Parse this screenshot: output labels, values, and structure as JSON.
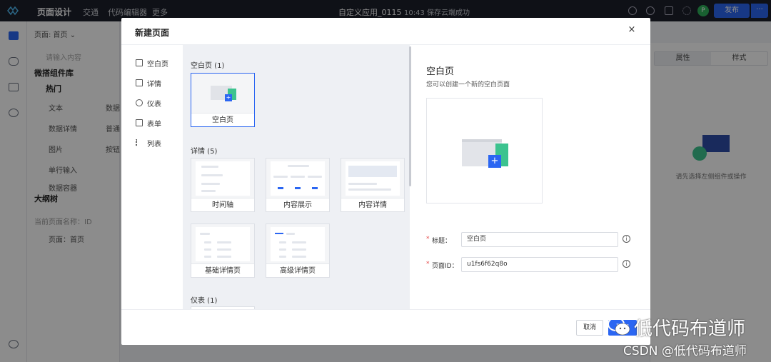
{
  "app": {
    "title": "页面设计",
    "nav": [
      "交通",
      "代码编辑器",
      "更多"
    ],
    "center_title": "自定义应用_0115",
    "save_status": "10:43 保存云端成功",
    "user_initial": "P",
    "publish_label": "发布",
    "more_label": "···"
  },
  "sidepanel": {
    "page_label": "页面: 首页 ⌄",
    "search_placeholder": "请输入内容",
    "library_title": "微搭组件库",
    "hot_title": "热门",
    "components": [
      "文本",
      "数据",
      "数据详情",
      "普通",
      "图片",
      "按钮",
      "单行输入",
      "数据容器"
    ],
    "outline_title": "大纲树",
    "outline_hint": "当前页面名称：ID",
    "outline_item": "页面：首页"
  },
  "rightpanel": {
    "tabs": [
      "属性",
      "样式"
    ],
    "hint": "请先选择左侧组件或操作"
  },
  "modal": {
    "title": "新建页面",
    "close": "×",
    "categories": [
      {
        "label": "空白页",
        "icon": "page-icon"
      },
      {
        "label": "详情",
        "icon": "detail-icon"
      },
      {
        "label": "仪表",
        "icon": "gauge-icon"
      },
      {
        "label": "表单",
        "icon": "checkbox-icon"
      },
      {
        "label": "列表",
        "icon": "list-icon"
      }
    ],
    "sections": {
      "blank": {
        "title": "空白页 (1)",
        "cards": [
          "空白页"
        ]
      },
      "detail": {
        "title": "详情 (5)",
        "cards": [
          "时间轴",
          "内容展示",
          "内容详情",
          "基础详情页",
          "高级详情页"
        ]
      },
      "dashboard": {
        "title": "仪表 (1)"
      }
    },
    "detail": {
      "title": "空白页",
      "desc": "您可以创建一个新的空白页面",
      "fields": [
        {
          "label": "标题：",
          "value": "空白页"
        },
        {
          "label": "页面ID：",
          "value": "u1fs6f62q8o"
        }
      ]
    },
    "footer": {
      "cancel": "取消",
      "confirm": "确定"
    }
  },
  "watermark": {
    "big": "低代码布道师",
    "small": "CSDN @低代码布道师"
  },
  "colors": {
    "accent": "#2b66f2",
    "required": "#e54545",
    "teal": "#3cc38f"
  }
}
